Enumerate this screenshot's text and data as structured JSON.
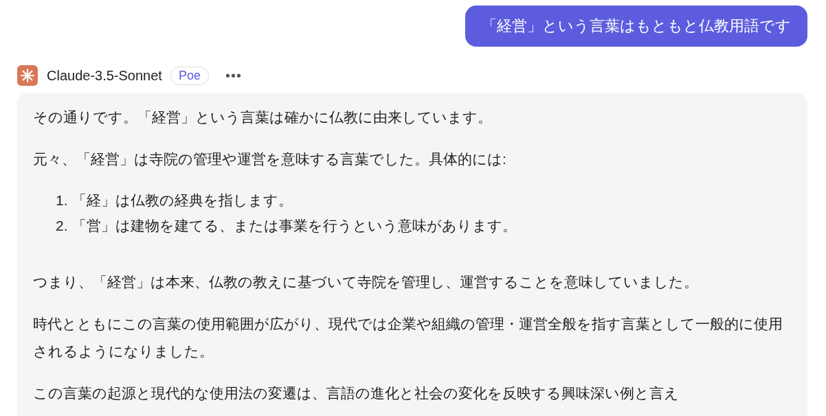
{
  "user_message": {
    "text": "「経営」という言葉はもともと仏教用語です"
  },
  "bot": {
    "name": "Claude-3.5-Sonnet",
    "badge": "Poe",
    "menu": "•••"
  },
  "response": {
    "blocks": [
      {
        "kind": "paragraph",
        "text": "その通りです。「経営」という言葉は確かに仏教に由来しています。"
      },
      {
        "kind": "paragraph",
        "text": "元々、「経営」は寺院の管理や運営を意味する言葉でした。具体的には:"
      },
      {
        "kind": "list",
        "items": [
          {
            "number": "1.",
            "text": "「経」は仏教の経典を指します。"
          },
          {
            "number": "2.",
            "text": "「営」は建物を建てる、または事業を行うという意味があります。"
          }
        ]
      },
      {
        "kind": "paragraph",
        "text": "つまり、「経営」は本来、仏教の教えに基づいて寺院を管理し、運営することを意味していました。"
      },
      {
        "kind": "paragraph",
        "text": "時代とともにこの言葉の使用範囲が広がり、現代では企業や組織の管理・運営全般を指す言葉として一般的に使用されるようになりました。"
      },
      {
        "kind": "paragraph",
        "text": "この言葉の起源と現代的な使用法の変遷は、言語の進化と社会の変化を反映する興味深い例と言え"
      }
    ]
  }
}
